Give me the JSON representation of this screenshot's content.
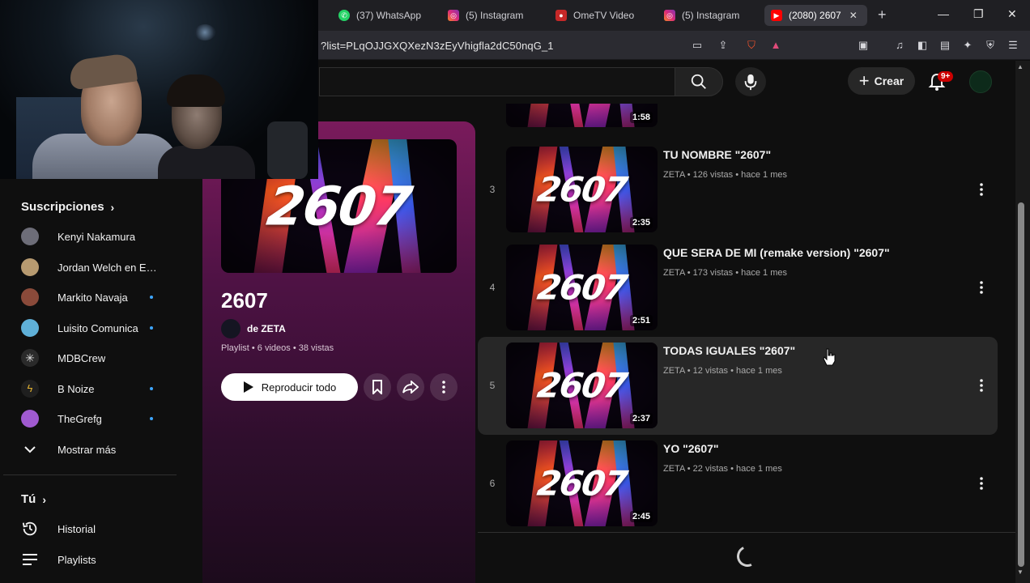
{
  "browser": {
    "tabs": [
      {
        "label": "(37) WhatsApp",
        "icon": "whatsapp-icon",
        "color": "#25d366"
      },
      {
        "label": "(5) Instagram",
        "icon": "instagram-icon",
        "color": "#e1306c"
      },
      {
        "label": "OmeTV Video",
        "icon": "ometv-icon",
        "color": "#e53935"
      },
      {
        "label": "(5) Instagram",
        "icon": "instagram-icon",
        "color": "#e1306c"
      },
      {
        "label": "(2080) 2607",
        "icon": "youtube-icon",
        "color": "#ff0000",
        "active": true
      }
    ],
    "url": "?list=PLqOJJGXQXezN3zEyVhigfla2dC50nqG_1"
  },
  "header": {
    "create_label": "Crear",
    "notifications": "9+"
  },
  "sidebar": {
    "subscriptions_title": "Suscripciones",
    "subscriptions": [
      {
        "name": "Kenyi Nakamura",
        "new": false,
        "color": "#6d6d78"
      },
      {
        "name": "Jordan Welch en Es...",
        "new": false,
        "color": "#b79a70"
      },
      {
        "name": "Markito Navaja",
        "new": true,
        "color": "#8a4a3a"
      },
      {
        "name": "Luisito Comunica",
        "new": true,
        "color": "#5fb0d8"
      },
      {
        "name": "MDBCrew",
        "new": false,
        "color": "#2a2a2a"
      },
      {
        "name": "B Noize",
        "new": true,
        "color": "#1f1f1f"
      },
      {
        "name": "TheGrefg",
        "new": true,
        "color": "#a05ad0"
      }
    ],
    "show_more": "Mostrar más",
    "you_title": "Tú",
    "history": "Historial",
    "playlists": "Playlists"
  },
  "playlist": {
    "title": "2607",
    "thumb_text": "2607",
    "owner": "de ZETA",
    "meta": "Playlist • 6 videos • 38 vistas",
    "play_all": "Reproducir todo"
  },
  "videos": [
    {
      "index": "",
      "title": "",
      "meta": "",
      "duration": "1:58"
    },
    {
      "index": "3",
      "title": "TU NOMBRE \"2607\"",
      "meta": "ZETA • 126 vistas • hace 1 mes",
      "duration": "2:35"
    },
    {
      "index": "4",
      "title": "QUE SERA DE MI (remake version) \"2607\"",
      "meta": "ZETA • 173 vistas • hace 1 mes",
      "duration": "2:51"
    },
    {
      "index": "5",
      "title": "TODAS IGUALES \"2607\"",
      "meta": "ZETA • 12 vistas • hace 1 mes",
      "duration": "2:37",
      "hover": true
    },
    {
      "index": "6",
      "title": "YO \"2607\"",
      "meta": "ZETA • 22 vistas • hace 1 mes",
      "duration": "2:45"
    }
  ]
}
